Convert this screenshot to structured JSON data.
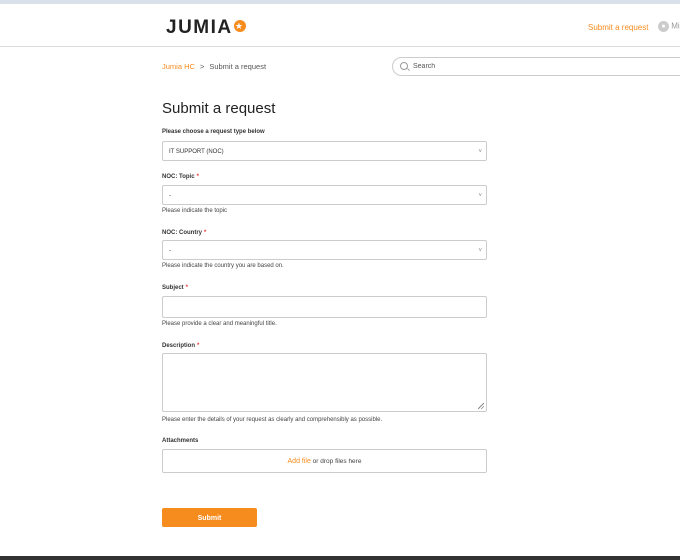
{
  "header": {
    "logo_text": "JUMIA",
    "submit_link": "Submit a request",
    "user_label": "Mi"
  },
  "breadcrumb": {
    "home": "Jumia HC",
    "separator": ">",
    "current": "Submit a request"
  },
  "search": {
    "placeholder": "Search"
  },
  "form": {
    "title": "Submit a request",
    "request_type": {
      "label": "Please choose a request type below",
      "value": "IT SUPPORT (NOC)"
    },
    "topic": {
      "label": "NOC: Topic",
      "value": "-",
      "hint": "Please indicate the topic"
    },
    "country": {
      "label": "NOC: Country",
      "value": "-",
      "hint": "Please indicate the country you are based on."
    },
    "subject": {
      "label": "Subject",
      "value": "",
      "hint": "Please provide a clear and meaningful title."
    },
    "description": {
      "label": "Description",
      "value": "",
      "hint": "Please enter the details of your request as clearly and comprehensibly as possible."
    },
    "attachments": {
      "label": "Attachments",
      "add_file": "Add file",
      "drop_text": " or drop files here"
    },
    "required_marker": "*",
    "submit_label": "Submit"
  },
  "colors": {
    "accent": "#f68b1e",
    "required": "#ee3333"
  }
}
